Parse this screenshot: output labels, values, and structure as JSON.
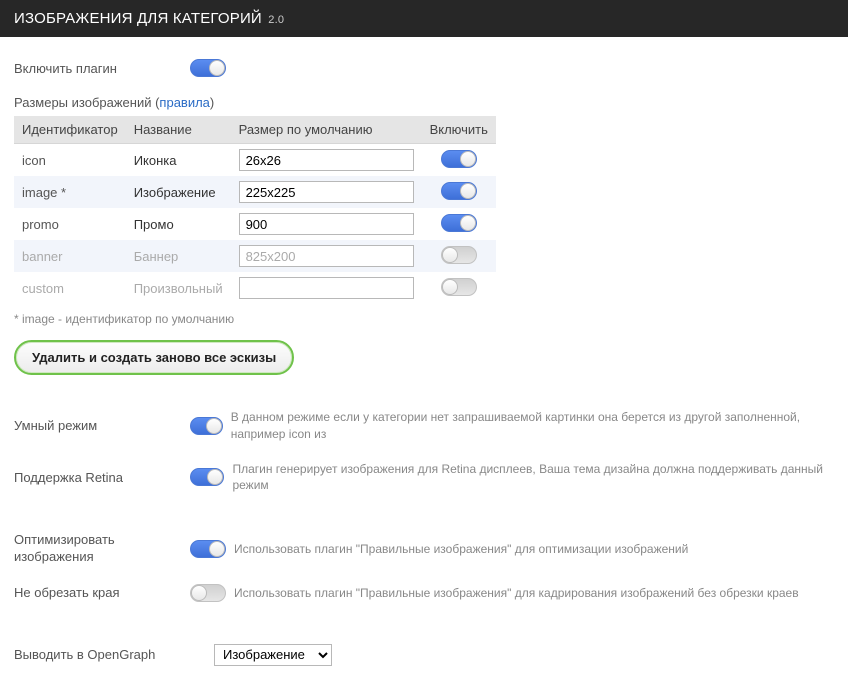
{
  "header": {
    "title": "ИЗОБРАЖЕНИЯ ДЛЯ КАТЕГОРИЙ",
    "version": "2.0"
  },
  "enable_plugin": {
    "label": "Включить плагин",
    "on": true
  },
  "sizes_section": {
    "title_prefix": "Размеры изображений (",
    "rules_link": "правила",
    "title_suffix": ")",
    "columns": {
      "id": "Идентификатор",
      "name": "Название",
      "size": "Размер по умолчанию",
      "enable": "Включить"
    },
    "rows": [
      {
        "id": "icon",
        "name": "Иконка",
        "size": "26x26",
        "on": true,
        "disabled": false
      },
      {
        "id": "image *",
        "name": "Изображение",
        "size": "225x225",
        "on": true,
        "disabled": false
      },
      {
        "id": "promo",
        "name": "Промо",
        "size": "900",
        "on": true,
        "disabled": false
      },
      {
        "id": "banner",
        "name": "Баннер",
        "size": "825x200",
        "on": false,
        "disabled": true
      },
      {
        "id": "custom",
        "name": "Произвольный",
        "size": "",
        "on": false,
        "disabled": true
      }
    ],
    "footnote": "* image - идентификатор по умолчанию",
    "regen_button": "Удалить и создать заново все эскизы"
  },
  "options": {
    "smart": {
      "label": "Умный режим",
      "on": true,
      "hint": "В данном режиме если у категории нет запрашиваемой картинки она берется из другой заполненной, например icon из"
    },
    "retina": {
      "label": "Поддержка Retina",
      "on": true,
      "hint": "Плагин генерирует изображения для Retina дисплеев, Ваша тема дизайна должна поддерживать данный режим"
    },
    "optimize": {
      "label": "Оптимизировать изображения",
      "on": true,
      "hint": "Использовать плагин \"Правильные изображения\" для оптимизации изображений"
    },
    "nocrop": {
      "label": "Не обрезать края",
      "on": false,
      "hint": "Использовать плагин \"Правильные изображения\" для кадрирования изображений без обрезки краев"
    }
  },
  "opengraph": {
    "label": "Выводить в OpenGraph",
    "selected": "Изображение"
  }
}
